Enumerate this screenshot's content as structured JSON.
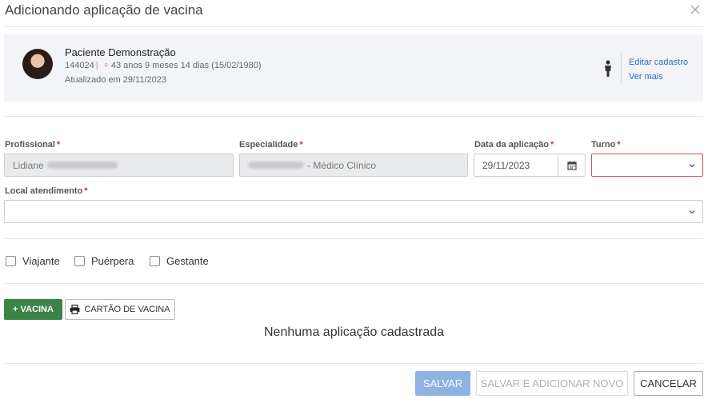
{
  "dialog": {
    "title": "Adicionando aplicação de vacina"
  },
  "patient": {
    "name": "Paciente Demonstração",
    "id": "144024",
    "age": "43 anos 9 meses 14 dias (15/02/1980)",
    "updated": "Atualizado em 29/11/2023",
    "edit_link": "Editar cadastro",
    "more_link": "Ver mais"
  },
  "form": {
    "profissional_label": "Profissional",
    "profissional_value": "Lidiane",
    "especialidade_label": "Especialidade",
    "especialidade_value": "- Médico Clínico",
    "data_label": "Data da aplicação",
    "data_value": "29/11/2023",
    "turno_label": "Turno",
    "turno_value": "",
    "local_label": "Local atendimento",
    "local_value": "",
    "required_mark": "*"
  },
  "checkboxes": {
    "viajante": "Viajante",
    "puerpera": "Puérpera",
    "gestante": "Gestante"
  },
  "actions": {
    "add_vacina": "+ VACINA",
    "cartao": "CARTÃO DE VACINA",
    "empty_message": "Nenhuma aplicação cadastrada"
  },
  "footer": {
    "save": "SALVAR",
    "save_add": "SALVAR E ADICIONAR NOVO",
    "cancel": "CANCELAR"
  },
  "colors": {
    "accent_green": "#3b8446",
    "save_blue": "#8fb3e0",
    "required_red": "#d32f2f",
    "link_blue": "#2c6fb5"
  }
}
